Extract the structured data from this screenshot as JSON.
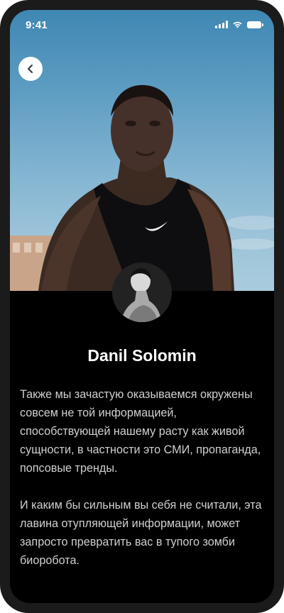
{
  "status_bar": {
    "time": "9:41"
  },
  "icons": {
    "signal": "signal-icon",
    "wifi": "wifi-icon",
    "battery": "battery-icon",
    "back": "chevron-left-icon"
  },
  "profile": {
    "name": "Danil Solomin",
    "bio": [
      "Также мы зачастую оказываемся окружены совсем не той информацией, способствующей нашему расту как живой сущности, в частности это СМИ, пропаганда, попсовые тренды.",
      "И каким бы сильным вы себя не считали, эта лавина отупляющей информации, может запросто превратить вас в тупого зомби биоробота."
    ]
  },
  "colors": {
    "background": "#000000",
    "text_primary": "#ffffff",
    "text_secondary": "#cfcfcf",
    "frame": "#1b1b1b"
  }
}
